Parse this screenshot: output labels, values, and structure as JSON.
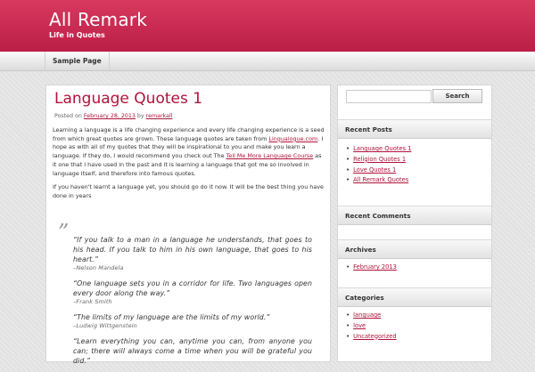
{
  "site": {
    "title": "All Remark",
    "tagline": "Life in Quotes"
  },
  "nav": {
    "items": [
      {
        "label": "Sample Page"
      }
    ]
  },
  "post": {
    "title": "Language Quotes 1",
    "meta_posted_on": "Posted on",
    "meta_date": "February 28, 2013",
    "meta_by": "by",
    "meta_author": "remarkall",
    "p1_text1": "Learning a language is a life changing experience and every life changing experience is a seed from which great quotes are grown. These language quotes are taken from ",
    "p1_link1": "Lingualogue.com",
    "p1_text2": ". I hope as with all of my quotes that they will be inspirational to you and make you learn a language. If they do, I would recommend you check out The ",
    "p1_link2": "Tell Me More Language Course",
    "p1_text3": " as it one that I have used in the past and it is learning a language that got me so involved in language itself, and therefore into famous quotes.",
    "p2": "If you haven't learnt a language yet, you should go do it now. It will be the best thing you have done in years",
    "quote_mark": "”",
    "quotes": [
      {
        "text": "“If you talk to a man in a language he understands, that goes to his head. If you talk to him in his own language, that goes to his heart.”",
        "author": "–Nelson Mandela"
      },
      {
        "text": "“One language sets you in a corridor for life. Two languages open every door along the way.”",
        "author": "–Frank Smith"
      },
      {
        "text": "“The limits of my language are the limits of my world.”",
        "author": "–Ludwig Wittgenstein"
      },
      {
        "text": "“Learn everything you can, anytime you can, from anyone you can; there will always come a time when you will be grateful you did.”",
        "author": ""
      }
    ]
  },
  "sidebar": {
    "search": {
      "placeholder": "",
      "button_label": "Search"
    },
    "recent_posts": {
      "title": "Recent Posts",
      "items": [
        "Language Quotes 1",
        "Religion Quotes 1",
        "Love Quotes 1",
        "All Remark Quotes"
      ]
    },
    "recent_comments": {
      "title": "Recent Comments"
    },
    "archives": {
      "title": "Archives",
      "items": [
        "February 2013"
      ]
    },
    "categories": {
      "title": "Categories",
      "items": [
        "language",
        "love",
        "Uncategorized"
      ]
    }
  },
  "colors": {
    "header": "#c4254e",
    "link": "#b0123c"
  }
}
